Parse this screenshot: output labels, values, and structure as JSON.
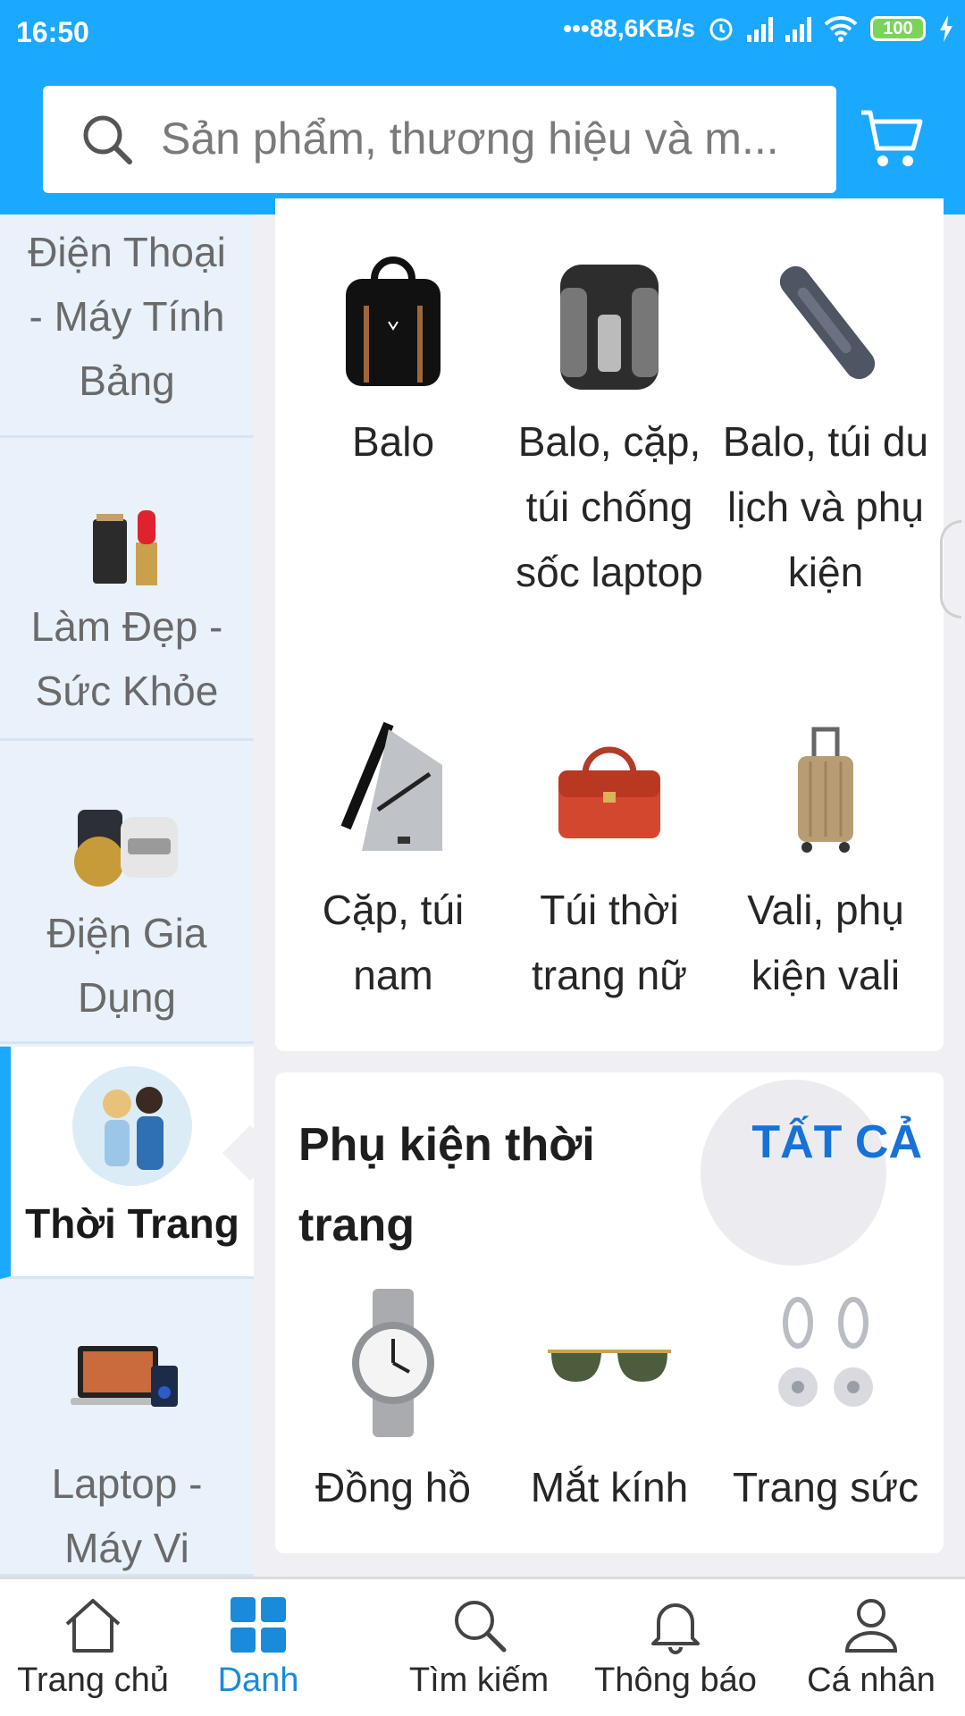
{
  "status_bar": {
    "time": "16:50",
    "network_speed": "88,6KB/s",
    "battery": "100"
  },
  "header": {
    "search_placeholder": "Sản phẩm, thương hiệu và m...",
    "search_icon": "search-icon",
    "cart_icon": "cart-icon",
    "accent_color": "#1ba8ff"
  },
  "sidebar": {
    "items": [
      {
        "label": "Điện Thoại - Máy Tính Bảng",
        "icon": "phone-tablet-icon"
      },
      {
        "label": "Làm Đẹp - Sức Khỏe",
        "icon": "cosmetics-icon"
      },
      {
        "label": "Điện Gia Dụng",
        "icon": "rice-cooker-icon"
      },
      {
        "label": "Thời Trang",
        "icon": "fashion-couple-icon",
        "active": true
      },
      {
        "label": "Laptop - Máy Vi",
        "icon": "laptop-icon"
      }
    ]
  },
  "bags_section": {
    "items": [
      {
        "label": "Balo",
        "icon": "backpack-icon"
      },
      {
        "label": "Balo, cặp, túi chống sốc laptop",
        "icon": "laptop-backpack-icon"
      },
      {
        "label": "Balo, túi du lịch và phụ kiện",
        "icon": "travel-accessory-icon"
      },
      {
        "label": "Cặp, túi nam",
        "icon": "sling-bag-icon"
      },
      {
        "label": "Túi thời trang nữ",
        "icon": "handbag-icon"
      },
      {
        "label": "Vali, phụ kiện vali",
        "icon": "suitcase-icon"
      }
    ]
  },
  "accessories_section": {
    "title": "Phụ kiện thời trang",
    "see_all": "TẤT CẢ",
    "items": [
      {
        "label": "Đồng hồ",
        "icon": "watch-icon"
      },
      {
        "label": "Mắt kính",
        "icon": "sunglasses-icon"
      },
      {
        "label": "Trang sức",
        "icon": "earrings-icon"
      }
    ]
  },
  "bottom_nav": {
    "items": [
      {
        "label": "Trang chủ",
        "icon": "home-icon"
      },
      {
        "label": "Danh",
        "icon": "category-grid-icon",
        "active": true
      },
      {
        "label": "Tìm kiếm",
        "icon": "search-icon"
      },
      {
        "label": "Thông báo",
        "icon": "bell-icon"
      },
      {
        "label": "Cá nhân",
        "icon": "user-icon"
      }
    ],
    "active_color": "#1a8bd8"
  }
}
